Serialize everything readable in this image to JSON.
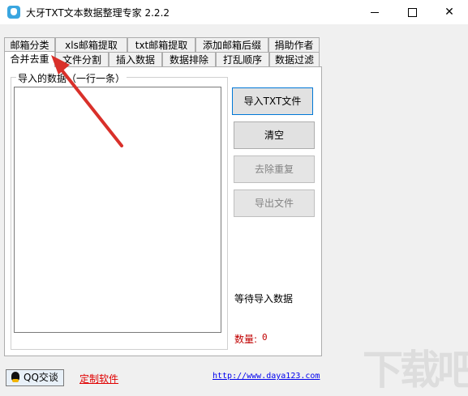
{
  "window": {
    "title": "大牙TXT文本数据整理专家 2.2.2",
    "min_glyph": "",
    "max_glyph": "",
    "close_glyph": "✕"
  },
  "tabs_row1": [
    "邮箱分类",
    "xls邮箱提取",
    "txt邮箱提取",
    "添加邮箱后缀",
    "捐助作者"
  ],
  "tabs_row2": [
    "合并去重",
    "文件分割",
    "插入数据",
    "数据排除",
    "打乱顺序",
    "数据过滤"
  ],
  "active_tab": "合并去重",
  "panel": {
    "group_label": "导入的数据（一行一条）",
    "textarea_value": "",
    "buttons": {
      "import": "导入TXT文件",
      "clear": "清空",
      "dedupe": "去除重复",
      "export": "导出文件"
    },
    "status": "等待导入数据",
    "count_label": "数量:",
    "count_value": "0"
  },
  "footer": {
    "qq_button": "QQ交谈",
    "custom_link": "定制软件",
    "url": "http://www.daya123.com"
  },
  "colors": {
    "accent": "#0078d7",
    "arrow": "#d9302a",
    "count": "#c00000",
    "custom_link": "#e00000",
    "url_link": "#0000ee"
  },
  "watermark": "下载吧"
}
